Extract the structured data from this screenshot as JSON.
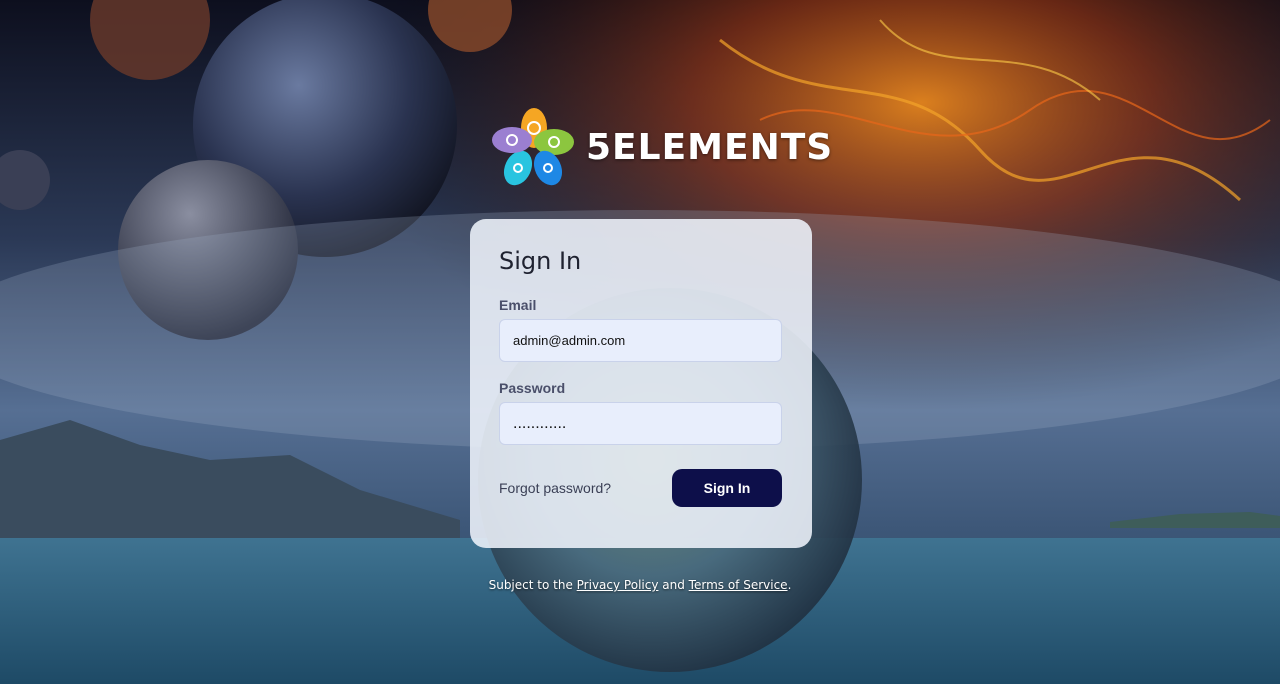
{
  "brand": {
    "name": "5ELEMENTS",
    "logo_icon": "five-petal-flower-logo"
  },
  "signin": {
    "title": "Sign In",
    "email_label": "Email",
    "email_value": "admin@admin.com",
    "password_label": "Password",
    "password_value": "............",
    "forgot_label": "Forgot password?",
    "submit_label": "Sign In"
  },
  "footer": {
    "prefix": "Subject to the",
    "privacy_label": "Privacy Policy",
    "and": "and",
    "terms_label": "Terms of Service",
    "suffix": "."
  },
  "colors": {
    "button": "#0d0f4a",
    "card": "#eef2fa",
    "input": "#e8eefc"
  }
}
